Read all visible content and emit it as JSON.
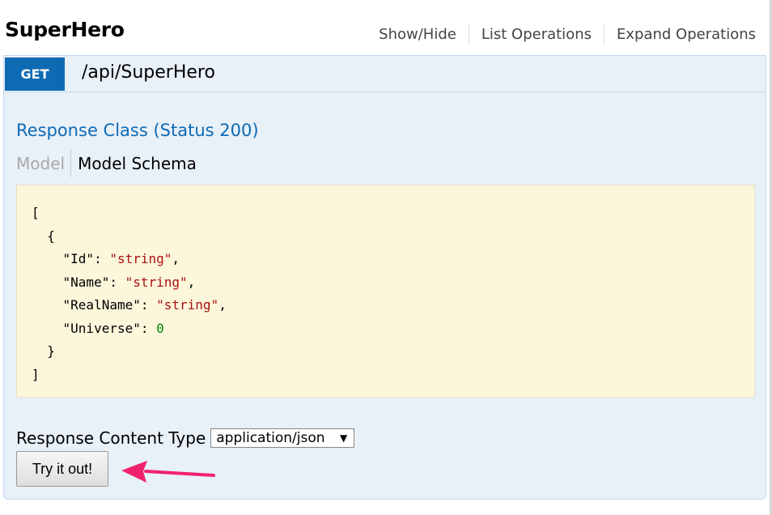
{
  "resource": {
    "title": "SuperHero",
    "links": [
      "Show/Hide",
      "List Operations",
      "Expand Operations"
    ]
  },
  "operation": {
    "method": "GET",
    "path": "/api/SuperHero",
    "response_class_label": "Response Class (Status 200)",
    "model_tab_label": "Model",
    "model_schema_tab_label": "Model Schema",
    "schema_lines": [
      {
        "text": "["
      },
      {
        "text": "  {"
      },
      {
        "key": "\"Id\"",
        "value": "\"string\"",
        "type": "string",
        "trailing": ","
      },
      {
        "key": "\"Name\"",
        "value": "\"string\"",
        "type": "string",
        "trailing": ","
      },
      {
        "key": "\"RealName\"",
        "value": "\"string\"",
        "type": "string",
        "trailing": ","
      },
      {
        "key": "\"Universe\"",
        "value": "0",
        "type": "number",
        "trailing": ""
      },
      {
        "text": "  }"
      },
      {
        "text": "]"
      }
    ],
    "content_type_label": "Response Content Type",
    "content_type_selected": "application/json",
    "try_button_label": "Try it out!"
  },
  "colors": {
    "method_get": "#0f6ab4",
    "response_class": "#0f6ab4",
    "schema_bg": "#fcf6db",
    "annotation_arrow": "#f0226b"
  }
}
